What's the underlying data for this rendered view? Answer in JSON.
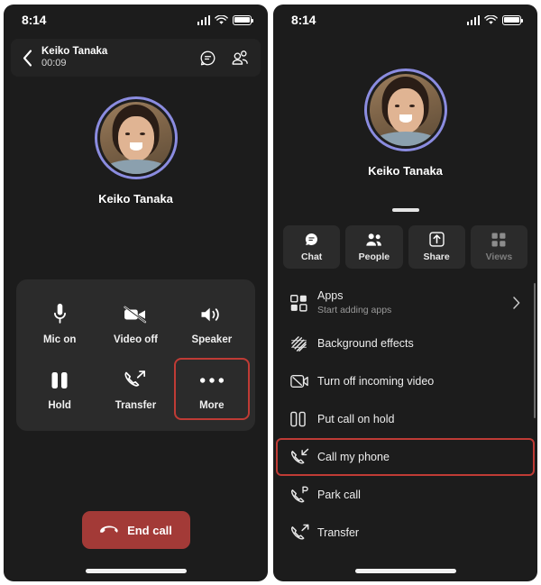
{
  "status_bar": {
    "time": "8:14",
    "icons": [
      "cellular-signal-icon",
      "wifi-icon",
      "battery-icon"
    ]
  },
  "colors": {
    "background": "#1c1c1c",
    "sheet": "#2b2b2b",
    "highlight_red": "#bf3b35",
    "end_call_red": "#a33a37",
    "avatar_ring": "#8b8ce0",
    "text_primary": "#ededed",
    "text_secondary": "#9a9a9a"
  },
  "left_panel": {
    "header": {
      "back_icon": "chevron-left-icon",
      "contact_name": "Keiko Tanaka",
      "call_duration": "00:09",
      "chat_icon": "chat-bubble-icon",
      "people_icon": "people-icon"
    },
    "participant": {
      "name": "Keiko Tanaka"
    },
    "controls": [
      {
        "label": "Mic on",
        "icon": "microphone-icon",
        "selected": false
      },
      {
        "label": "Video off",
        "icon": "video-off-icon",
        "selected": false
      },
      {
        "label": "Speaker",
        "icon": "speaker-icon",
        "selected": false
      },
      {
        "label": "Hold",
        "icon": "pause-icon",
        "selected": false
      },
      {
        "label": "Transfer",
        "icon": "call-transfer-icon",
        "selected": false
      },
      {
        "label": "More",
        "icon": "more-dots-icon",
        "selected": true
      }
    ],
    "end_call": {
      "label": "End call",
      "icon": "hang-up-icon"
    }
  },
  "right_panel": {
    "participant": {
      "name": "Keiko Tanaka"
    },
    "tabs": [
      {
        "label": "Chat",
        "icon": "chat-bubble-icon",
        "disabled": false
      },
      {
        "label": "People",
        "icon": "people-icon",
        "disabled": false
      },
      {
        "label": "Share",
        "icon": "share-up-icon",
        "disabled": false
      },
      {
        "label": "Views",
        "icon": "grid-icon",
        "disabled": true
      }
    ],
    "menu_items": [
      {
        "label": "Apps",
        "sublabel": "Start adding apps",
        "icon": "apps-grid-icon",
        "chevron": true,
        "selected": false
      },
      {
        "label": "Background effects",
        "sublabel": "",
        "icon": "background-effects-icon",
        "chevron": false,
        "selected": false
      },
      {
        "label": "Turn off incoming video",
        "sublabel": "",
        "icon": "video-off-box-icon",
        "chevron": false,
        "selected": false
      },
      {
        "label": "Put call on hold",
        "sublabel": "",
        "icon": "pause-icon",
        "chevron": false,
        "selected": false
      },
      {
        "label": "Call my phone",
        "sublabel": "",
        "icon": "call-incoming-icon",
        "chevron": false,
        "selected": true
      },
      {
        "label": "Park call",
        "sublabel": "",
        "icon": "call-park-icon",
        "chevron": false,
        "selected": false
      },
      {
        "label": "Transfer",
        "sublabel": "",
        "icon": "call-transfer-icon",
        "chevron": false,
        "selected": false
      }
    ]
  }
}
